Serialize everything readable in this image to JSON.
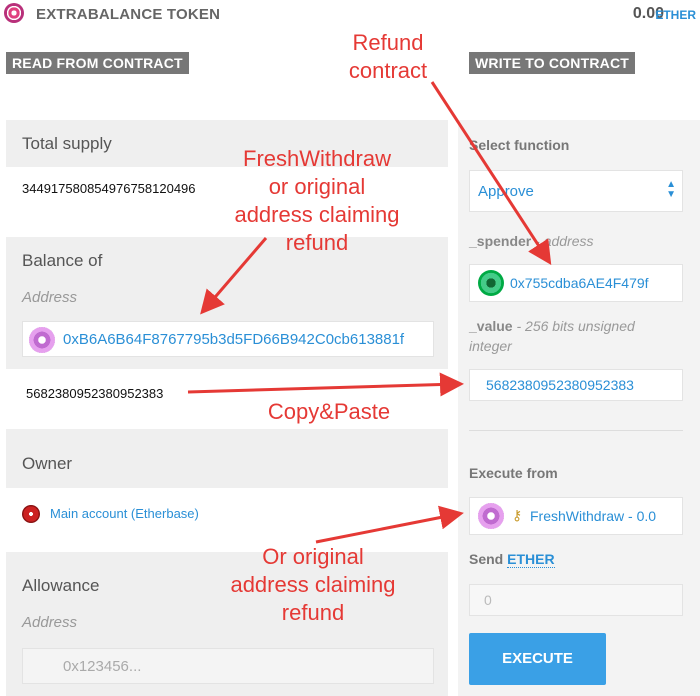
{
  "header": {
    "title": "EXTRABALANCE TOKEN",
    "balance_value": "0.00",
    "balance_unit": "ETHER"
  },
  "read": {
    "section_label": "READ FROM CONTRACT",
    "total_supply": {
      "label": "Total supply",
      "value": "3449175808549767581204​96"
    },
    "balance_of": {
      "label": "Balance of",
      "address_label": "Address",
      "address_value": "0xB6A6B64F8767795b3d5FD66B942C0cb613881f",
      "result": "5682380952380952383"
    },
    "owner": {
      "label": "Owner",
      "value": "Main account (Etherbase)"
    },
    "allowance": {
      "label": "Allowance",
      "address_label": "Address",
      "address_placeholder": "0x123456..."
    }
  },
  "write": {
    "section_label": "WRITE TO CONTRACT",
    "select_function_label": "Select function",
    "select_function_value": "Approve",
    "spender_label": "_spender",
    "spender_type": "- address",
    "spender_value": "0x755cdba6AE4F479f",
    "value_label": "_value",
    "value_type": "- 256 bits unsigned integer",
    "value_value": "5682380952380952383",
    "execute_from_label": "Execute from",
    "execute_from_value": "FreshWithdraw - 0.0",
    "send_label": "Send",
    "send_unit": "ETHER",
    "send_value": "0",
    "execute_label": "EXECUTE"
  },
  "annotations": {
    "refund_contract": [
      "Refund",
      "contract"
    ],
    "freshwithdraw": [
      "FreshWithdraw",
      "or original",
      "address claiming",
      "refund"
    ],
    "copy_paste": "Copy&Paste",
    "or_original": [
      "Or original",
      "address claiming",
      "refund"
    ]
  },
  "colors": {
    "accent": "#2a8fd6",
    "annotation": "#e53935",
    "button": "#3aa0e6"
  }
}
